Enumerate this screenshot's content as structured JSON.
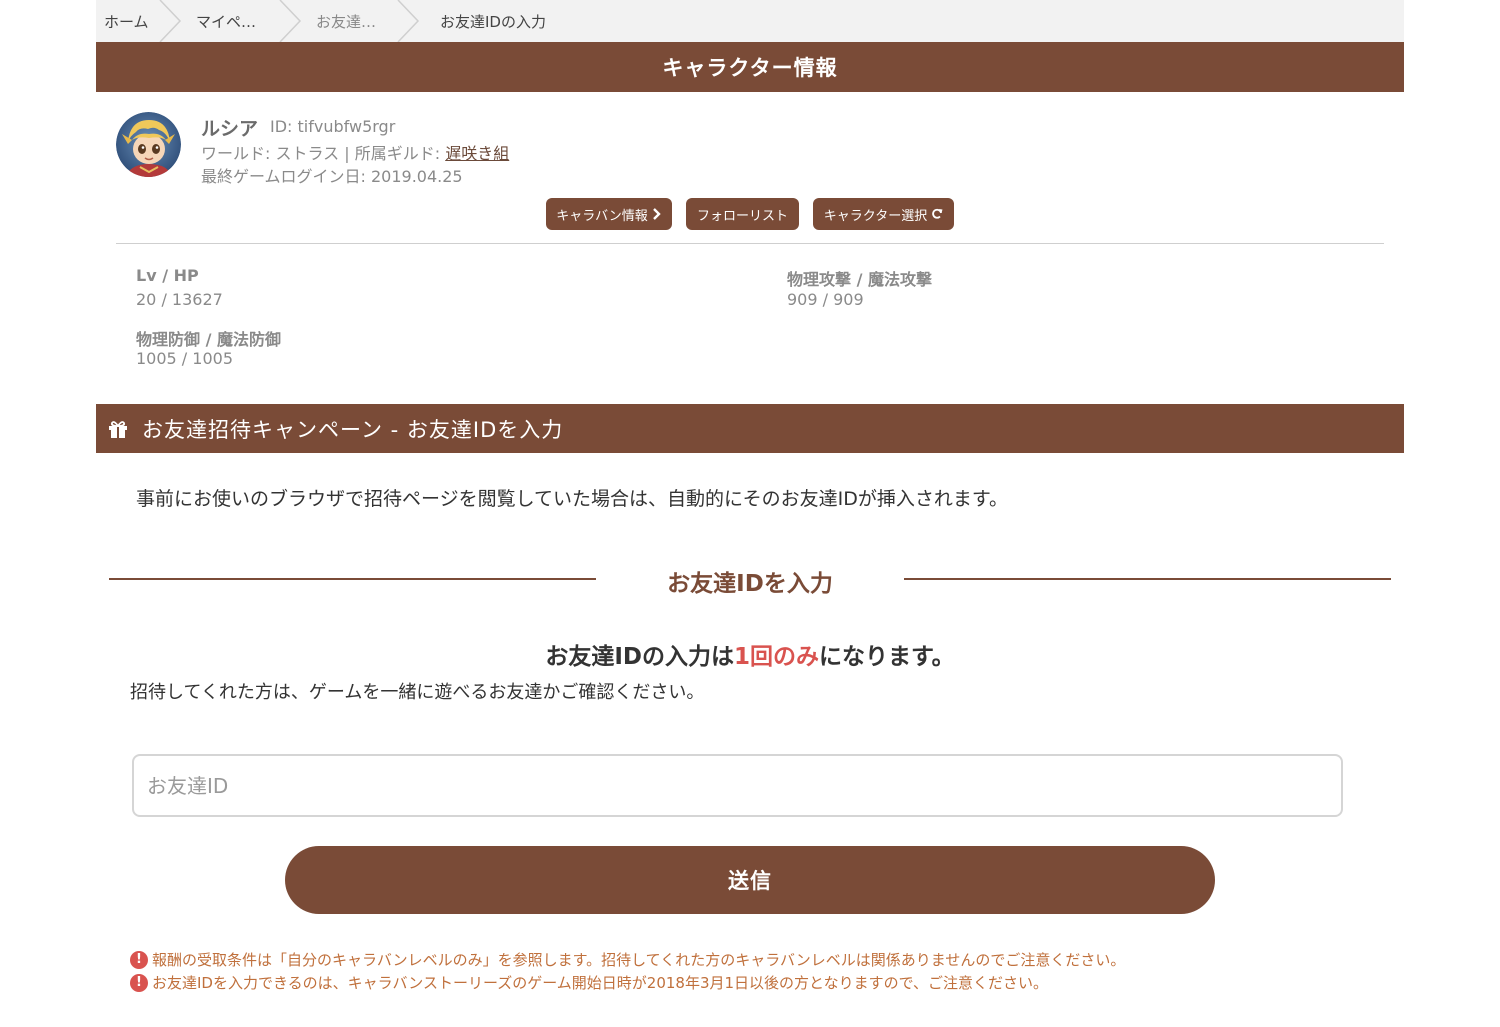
{
  "breadcrumb": [
    {
      "label": "ホーム"
    },
    {
      "label": "マイペ…"
    },
    {
      "label": "お友達…"
    },
    {
      "label": "お友達IDの入力"
    }
  ],
  "character_header": "キャラクター情報",
  "character": {
    "name": "ルシア",
    "id_text": "ID: tifvubfw5rgr",
    "world_label": "ワールド: ストラス  | 所属ギルド: ",
    "guild": "遅咲き組",
    "last_login": "最終ゲームログイン日: 2019.04.25"
  },
  "buttons": {
    "caravan": "キャラバン情報",
    "follow": "フォローリスト",
    "select": "キャラクター選択"
  },
  "stats": [
    {
      "label": "Lv / HP",
      "value": "20 / 13627"
    },
    {
      "label": "物理攻撃 / 魔法攻撃",
      "value": "909 / 909"
    },
    {
      "label": "物理防御 / 魔法防御",
      "value": "1005 / 1005"
    }
  ],
  "campaign_header": "お友達招待キャンペーン - お友達IDを入力",
  "notice": "事前にお使いのブラウザで招待ページを閲覧していた場合は、自動的にそのお友達IDが挿入されます。",
  "section_title": "お友達IDを入力",
  "once": {
    "before": "お友達IDの入力は",
    "emphasis": "1回のみ",
    "after": "になります。"
  },
  "confirm": "招待してくれた方は、ゲームを一緒に遊べるお友達かご確認ください。",
  "input": {
    "placeholder": "お友達ID",
    "value": ""
  },
  "submit_label": "送信",
  "warnings": [
    "報酬の受取条件は「自分のキャラバンレベルのみ」を参照します。招待してくれた方のキャラバンレベルは関係ありませんのでご注意ください。",
    "お友達IDを入力できるのは、キャラバンストーリーズのゲーム開始日時が2018年3月1日以後の方となりますので、ご注意ください。"
  ],
  "colors": {
    "brand": "#7a4b37",
    "emphasis": "#d9534f",
    "warning_text": "#c0703c"
  },
  "icons": {
    "campaign": "gift-icon",
    "caravan_button": "chevron-right-icon",
    "select_button": "refresh-icon",
    "warning": "exclamation-circle-icon"
  }
}
